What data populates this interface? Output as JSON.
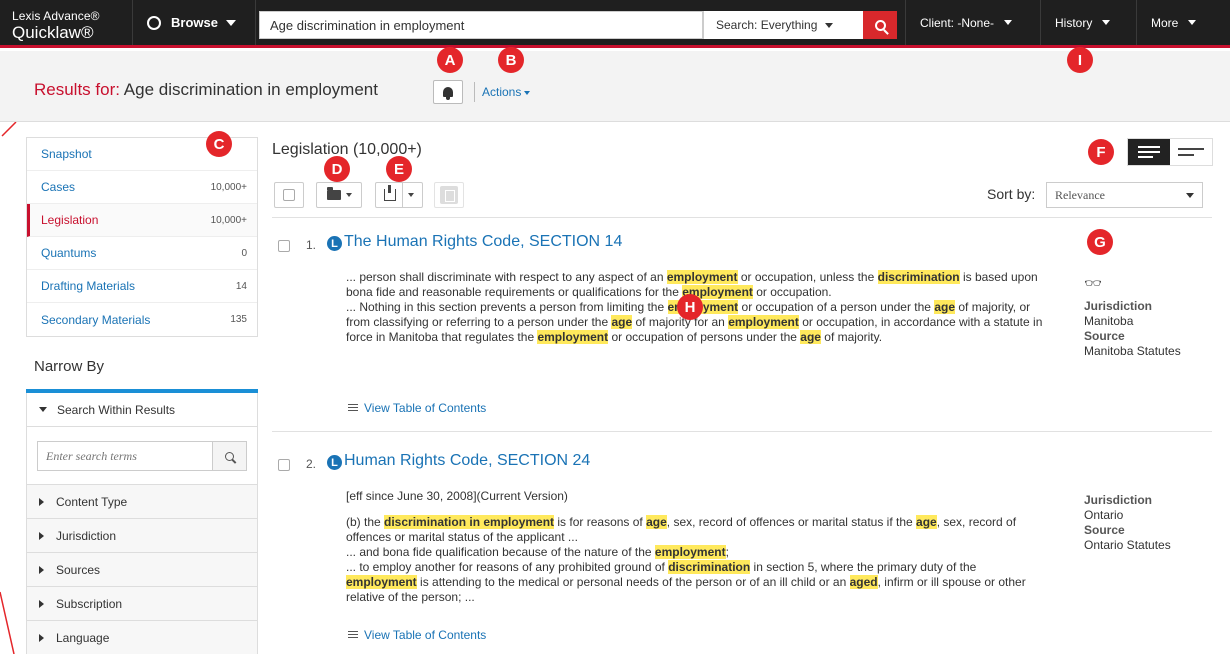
{
  "app": {
    "logo_line1": "Lexis Advance®",
    "logo_line2": "Quicklaw®"
  },
  "topbar": {
    "browse_label": "Browse",
    "search_value": "Age discrimination in employment",
    "search_scope": "Search: Everything",
    "client_label": "Client: -None-",
    "history_label": "History",
    "more_label": "More"
  },
  "header": {
    "results_prefix": "Results for:",
    "query": "Age discrimination in employment",
    "actions_label": "Actions"
  },
  "callouts": [
    "A",
    "B",
    "C",
    "D",
    "E",
    "F",
    "G",
    "H",
    "I"
  ],
  "facets": [
    {
      "label": "Snapshot",
      "count": ""
    },
    {
      "label": "Cases",
      "count": "10,000+"
    },
    {
      "label": "Legislation",
      "count": "10,000+"
    },
    {
      "label": "Quantums",
      "count": "0"
    },
    {
      "label": "Drafting Materials",
      "count": "14"
    },
    {
      "label": "Secondary Materials",
      "count": "135"
    }
  ],
  "narrow": {
    "title": "Narrow By",
    "search_within": "Search Within Results",
    "search_placeholder": "Enter search terms",
    "filters": [
      "Content Type",
      "Jurisdiction",
      "Sources",
      "Subscription",
      "Language"
    ]
  },
  "main": {
    "section_title": "Legislation (10,000+)",
    "sort_label": "Sort by:",
    "sort_value": "Relevance",
    "toc_label": "View Table of Contents",
    "jurisdiction_label": "Jurisdiction",
    "source_label": "Source"
  },
  "results": [
    {
      "number": "1.",
      "title": "The Human Rights Code, SECTION 14",
      "jurisdiction": "Manitoba",
      "source": "Manitoba Statutes"
    },
    {
      "number": "2.",
      "title": "Human Rights Code, SECTION 24",
      "status": "[eff since June 30, 2008](Current Version)",
      "jurisdiction": "Ontario",
      "source": "Ontario Statutes"
    }
  ],
  "colors": {
    "brand_red": "#c8102e",
    "link_blue": "#1a73b5",
    "highlight": "#ffe95c",
    "callout": "#e4262a"
  }
}
